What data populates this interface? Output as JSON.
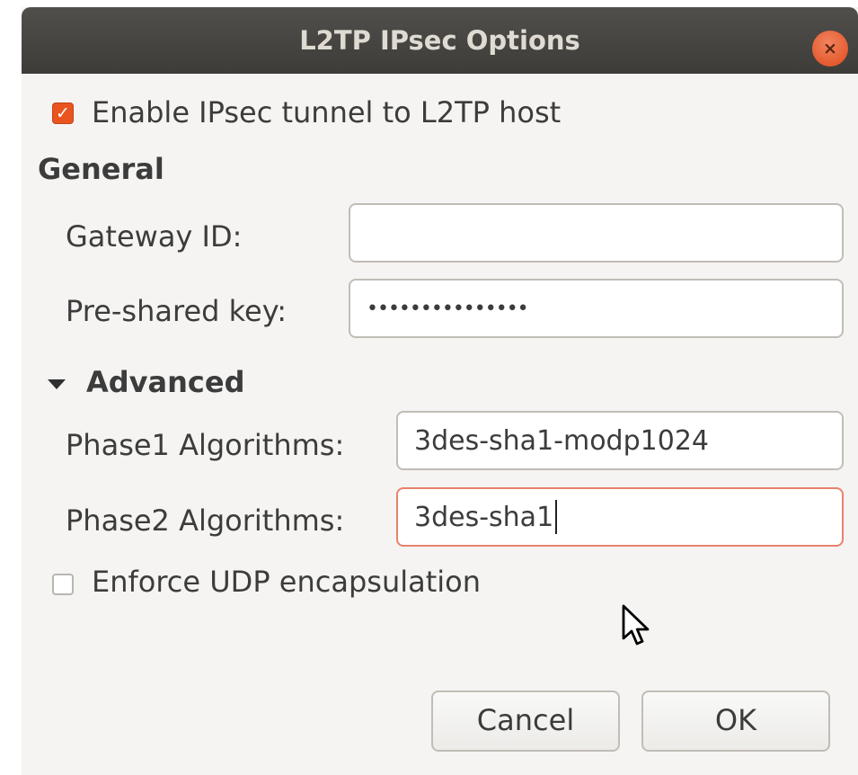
{
  "window": {
    "title": "L2TP IPsec Options",
    "close_label": "×"
  },
  "enable_ipsec": {
    "label": "Enable IPsec tunnel to L2TP host",
    "checked": true
  },
  "general": {
    "heading": "General",
    "gateway_id": {
      "label": "Gateway ID:",
      "value": ""
    },
    "pre_shared_key": {
      "label": "Pre-shared key:",
      "value": "•••••••••••••••"
    }
  },
  "advanced": {
    "heading": "Advanced",
    "expanded": true,
    "phase1": {
      "label": "Phase1 Algorithms:",
      "value": "3des-sha1-modp1024"
    },
    "phase2": {
      "label": "Phase2 Algorithms:",
      "value": "3des-sha1"
    }
  },
  "enforce_udp": {
    "label": "Enforce UDP encapsulation",
    "checked": false
  },
  "buttons": {
    "cancel": "Cancel",
    "ok": "OK"
  },
  "colors": {
    "accent": "#e95420",
    "titlebar": "#3d3c39",
    "background": "#f5f4f2",
    "focus_border": "#e8826b"
  }
}
